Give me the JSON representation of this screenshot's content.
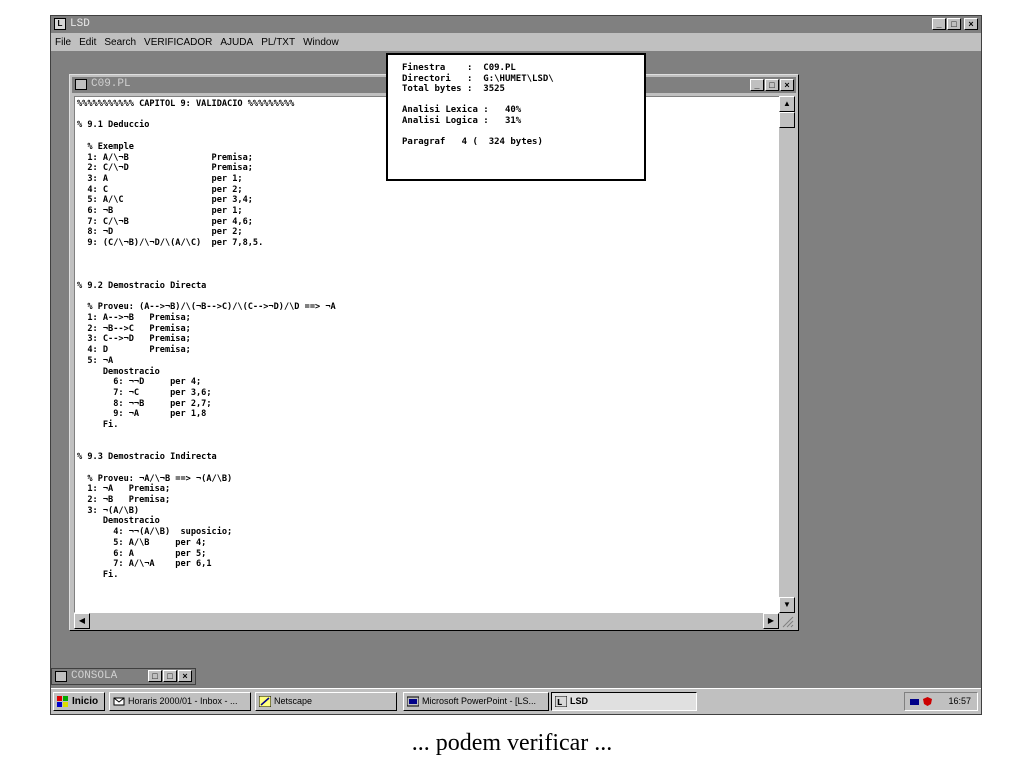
{
  "app": {
    "title": "LSD",
    "icon": "lsd-app-icon",
    "window_buttons": [
      "_",
      "□",
      "×"
    ]
  },
  "menu": [
    "File",
    "Edit",
    "Search",
    "VERIFICADOR",
    "AJUDA",
    "PL/TXT",
    "Window"
  ],
  "editor_window": {
    "title": "C09.PL",
    "window_buttons": [
      "_",
      "□",
      "×"
    ],
    "content": "%%%%%%%%%%% CAPITOL 9: VALIDACIO %%%%%%%%%\n\n% 9.1 Deduccio\n\n  % Exemple\n  1: A/\\¬B                Premisa;\n  2: C/\\¬D                Premisa;\n  3: A                    per 1;\n  4: C                    per 2;\n  5: A/\\C                 per 3,4;\n  6: ¬B                   per 1;\n  7: C/\\¬B                per 4,6;\n  8: ¬D                   per 2;\n  9: (C/\\¬B)/\\¬D/\\(A/\\C)  per 7,8,5.\n\n\n\n% 9.2 Demostracio Directa\n\n  % Proveu: (A-->¬B)/\\(¬B-->C)/\\(C-->¬D)/\\D ==> ¬A\n  1: A-->¬B   Premisa;\n  2: ¬B-->C   Premisa;\n  3: C-->¬D   Premisa;\n  4: D        Premisa;\n  5: ¬A\n     Demostracio\n       6: ¬¬D     per 4;\n       7: ¬C      per 3,6;\n       8: ¬¬B     per 2,7;\n       9: ¬A      per 1,8\n     Fi.\n\n\n% 9.3 Demostracio Indirecta\n\n  % Proveu: ¬A/\\¬B ==> ¬(A/\\B)\n  1: ¬A   Premisa;\n  2: ¬B   Premisa;\n  3: ¬(A/\\B)\n     Demostracio\n       4: ¬¬(A/\\B)  suposicio;\n       5: A/\\B     per 4;\n       6: A        per 5;\n       7: A/\\¬A    per 6,1\n     Fi."
  },
  "info_box": {
    "content": "Finestra    :  C09.PL\nDirectori   :  G:\\HUMET\\LSD\\\nTotal bytes :  3525\n\nAnalisi Lexica :   40%\nAnalisi Logica :   31%\n\nParagraf   4 (  324 bytes)"
  },
  "console": {
    "title": "CONSOLA",
    "window_buttons": [
      "□",
      "□",
      "×"
    ]
  },
  "taskbar": {
    "start_label": "Inicio",
    "buttons": [
      {
        "label": "Horaris 2000/01 - Inbox - ...",
        "icon": "mail-icon"
      },
      {
        "label": "Netscape",
        "icon": "netscape-icon"
      },
      {
        "label": "Microsoft PowerPoint - [LS...",
        "icon": "powerpoint-icon"
      },
      {
        "label": "LSD",
        "icon": "lsd-app-icon"
      }
    ],
    "clock": "16:57"
  },
  "caption": "... podem verificar ...",
  "colors": {
    "desktop_gray": "#808080",
    "face_gray": "#c0c0c0",
    "editor_bg": "#ffffff"
  }
}
